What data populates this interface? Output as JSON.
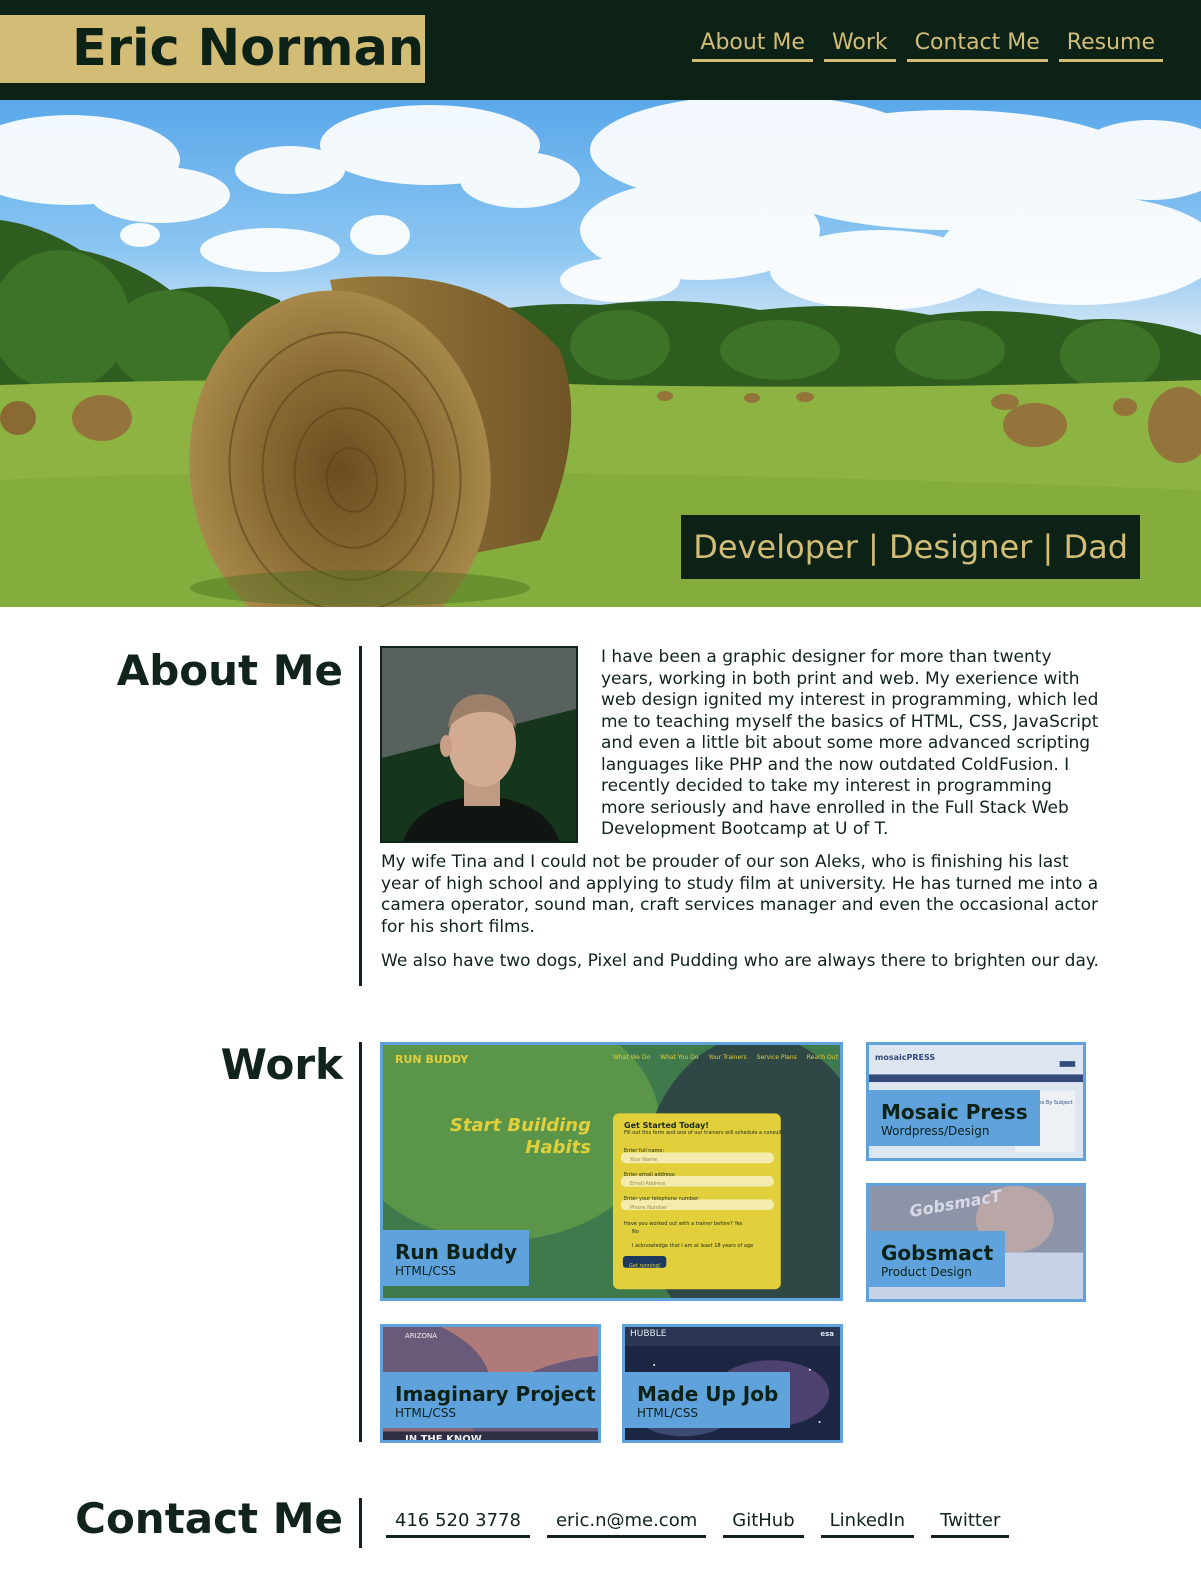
{
  "header": {
    "name": "Eric Normann",
    "nav": [
      {
        "label": "About Me"
      },
      {
        "label": "Work"
      },
      {
        "label": "Contact Me"
      },
      {
        "label": "Resume"
      }
    ]
  },
  "hero": {
    "tagline": "Developer | Designer | Dad"
  },
  "about": {
    "title": "About Me",
    "paragraphs": [
      "I have been a graphic designer for more than twenty years, working in both print and web. My exerience with web design ignited my interest in programming, which led me to teaching myself the basics of HTML, CSS, JavaScript and even a little bit about some more advanced scripting languages like PHP and the now outdated ColdFusion. I recently decided to take my interest in programming more seriously and have enrolled in the Full Stack Web Development Bootcamp at U of T.",
      "My wife Tina and I could not be prouder of our son Aleks, who is finishing his last year of high school and applying to study film at university. He has turned me into a camera operator, sound man, craft services manager and even the occasional actor for his short films.",
      "We also have two dogs, Pixel and Pudding who are always there to brighten our day."
    ]
  },
  "work": {
    "title": "Work",
    "projects": [
      {
        "title": "Run Buddy",
        "subtitle": "HTML/CSS",
        "preview": {
          "brand": "RUN BUDDY",
          "nav": [
            "What We Do",
            "What You Do",
            "Your Trainers",
            "Service Plans",
            "Reach Out"
          ],
          "headline_1": "Start Building",
          "headline_2": "Habits",
          "form_title": "Get Started Today!",
          "form_text": "Fill out this form and one of our trainers will schedule a consult",
          "fields": [
            {
              "label": "Enter full name:",
              "placeholder": "Your Name"
            },
            {
              "label": "Enter email address:",
              "placeholder": "Email Address"
            },
            {
              "label": "Enter your telephone number:",
              "placeholder": "Phone Number"
            }
          ],
          "question": "Have you worked out with a trainer before?",
          "yes": "Yes",
          "no": "No",
          "agree": "I acknowledge that I am at least 18 years of age",
          "button": "Get running!"
        }
      },
      {
        "title": "Mosaic Press",
        "subtitle": "Wordpress/Design",
        "preview": {
          "brand": "mosaicPRESS",
          "sidebar_title": "Titles By Subject"
        }
      },
      {
        "title": "Gobsmact",
        "subtitle": "Product Design",
        "preview": {
          "brand": "GobsmacT"
        }
      },
      {
        "title": "Imaginary Project",
        "subtitle": "HTML/CSS",
        "preview": {
          "brand": "ARIZONA",
          "footer": "IN THE KNOW"
        }
      },
      {
        "title": "Made Up Job",
        "subtitle": "HTML/CSS",
        "preview": {
          "brand": "HUBBLE",
          "agency": "esa"
        }
      }
    ]
  },
  "contact": {
    "title": "Contact Me",
    "links": [
      {
        "label": "416 520 3778"
      },
      {
        "label": "eric.n@me.com"
      },
      {
        "label": "GitHub"
      },
      {
        "label": "LinkedIn"
      },
      {
        "label": "Twitter"
      }
    ]
  },
  "colors": {
    "dark_green": "#0c2217",
    "gold": "#d3bd76",
    "card_blue": "#5fa2dc",
    "text": "#10241c"
  }
}
